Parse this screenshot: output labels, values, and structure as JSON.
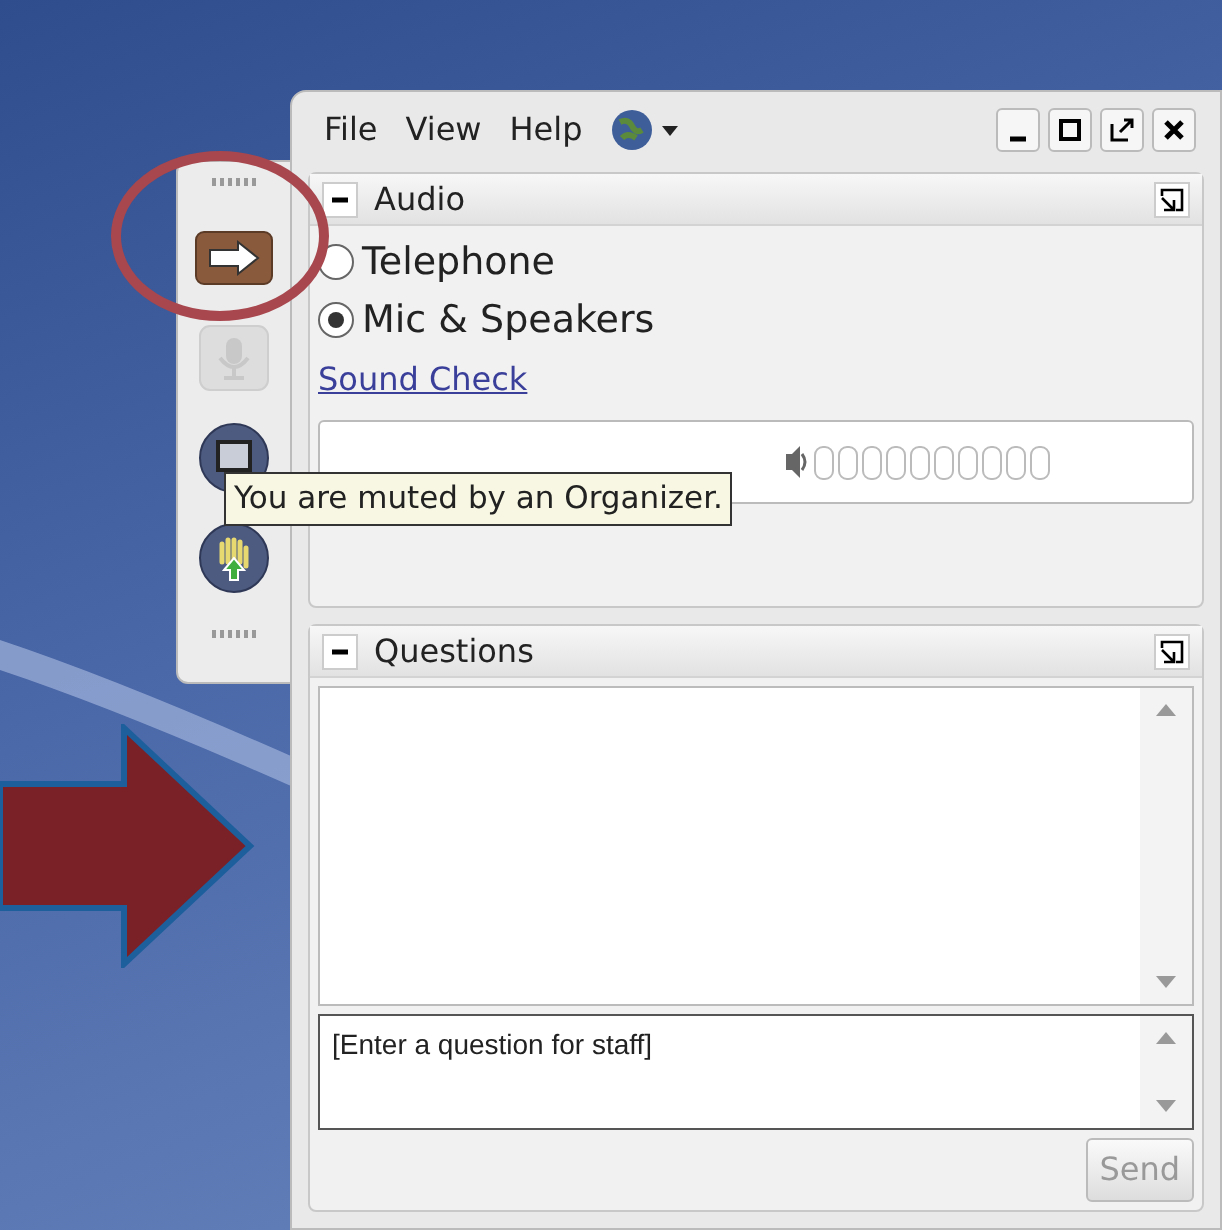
{
  "menu": [
    {
      "label": "File"
    },
    {
      "label": "View"
    },
    {
      "label": "Help"
    }
  ],
  "toolbar": [
    {
      "kind": "arrow",
      "disabled": false
    },
    {
      "kind": "mic",
      "disabled": true
    },
    {
      "kind": "screen",
      "disabled": false
    },
    {
      "kind": "hand",
      "disabled": false
    }
  ],
  "audio": {
    "title": "Audio",
    "expanded": true,
    "options": [
      {
        "label": "Telephone",
        "selected": false
      },
      {
        "label": "Mic & Speakers",
        "selected": true
      }
    ],
    "sound_check": "Sound Check"
  },
  "tooltip": "You are muted by an Organizer.",
  "questions": {
    "title": "Questions",
    "expanded": true,
    "placeholder": "[Enter a question for staff]",
    "send": "Send",
    "send_disabled": true
  }
}
